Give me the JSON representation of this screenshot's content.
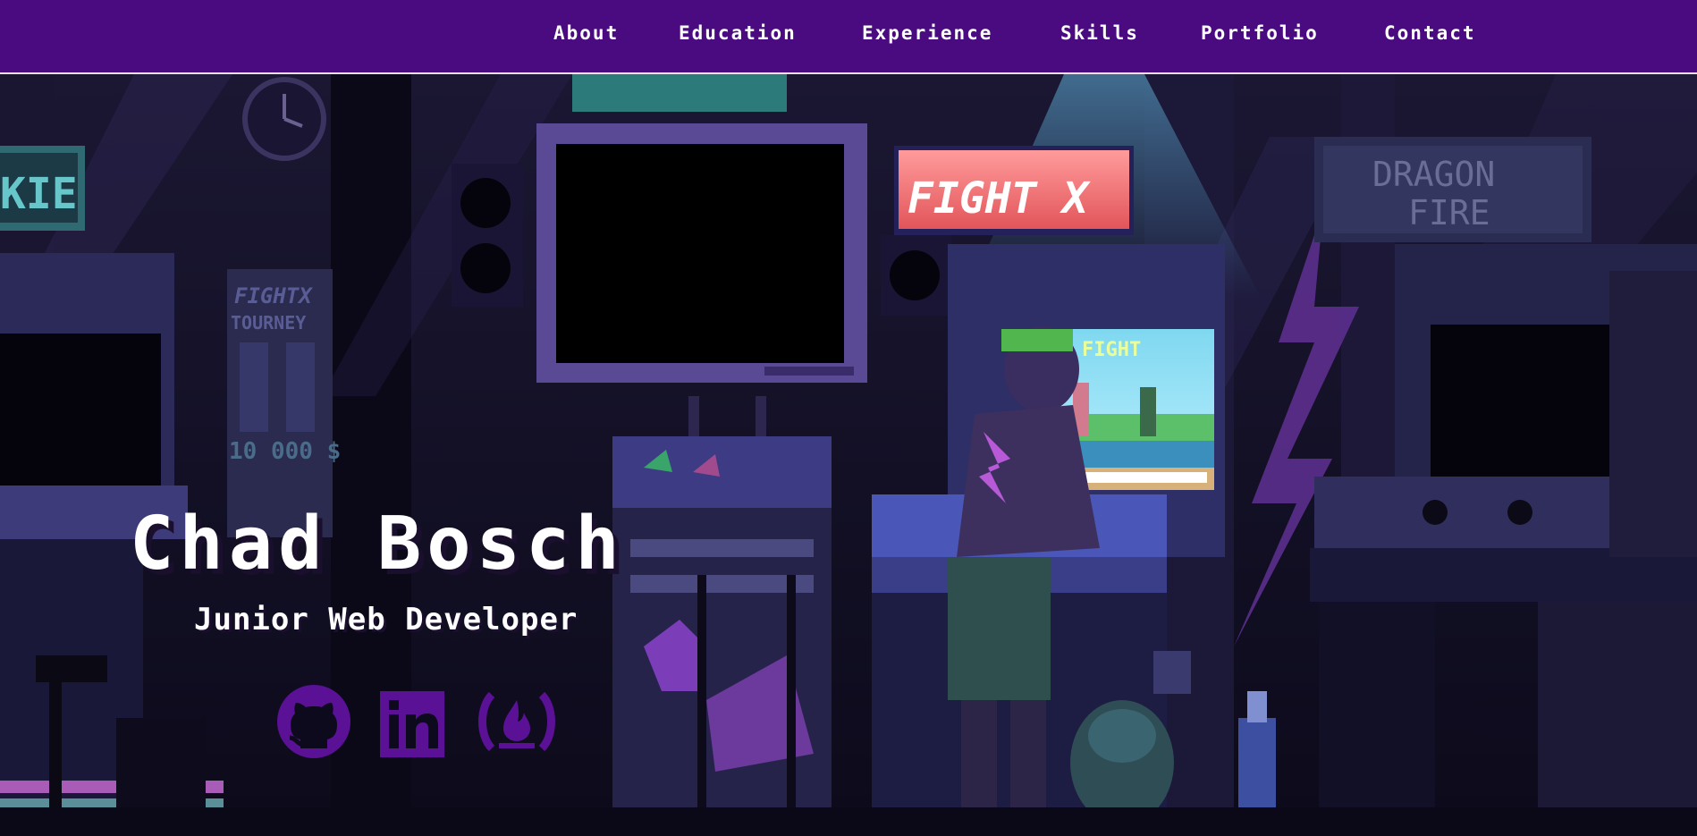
{
  "nav": {
    "items": [
      {
        "label": "About"
      },
      {
        "label": "Education"
      },
      {
        "label": "Experience"
      },
      {
        "label": "Skills"
      },
      {
        "label": "Portfolio"
      },
      {
        "label": "Contact"
      }
    ]
  },
  "hero": {
    "name": "Chad Bosch",
    "title": "Junior Web Developer",
    "background_signs": {
      "left_sign": "KIE",
      "poster_line1": "FIGHTX",
      "poster_line2": "TOURNEY",
      "poster_prize": "10 000 $",
      "neon_sign": "FIGHT X",
      "arcade_screen": "FIGHT",
      "dragon_sign_line1": "DRAGON",
      "dragon_sign_line2": "FIRE"
    },
    "social": [
      {
        "icon": "github-icon"
      },
      {
        "icon": "linkedin-icon"
      },
      {
        "icon": "freecodecamp-icon"
      }
    ]
  },
  "colors": {
    "nav_bg": "#4b0b80",
    "accent_purple": "#5a1196",
    "text": "#ffffff"
  }
}
